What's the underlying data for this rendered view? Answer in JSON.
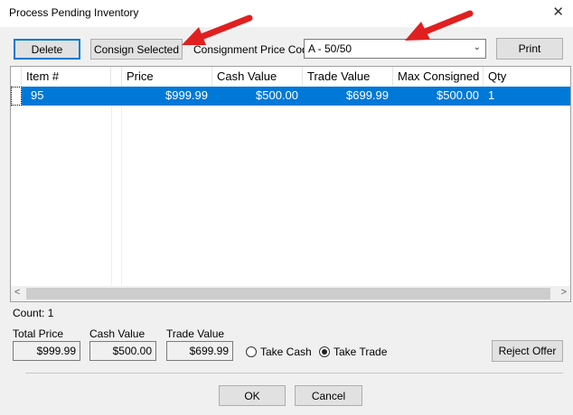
{
  "window": {
    "title": "Process Pending Inventory"
  },
  "toolbar": {
    "delete_label": "Delete",
    "consign_selected_label": "Consign Selected",
    "price_code_label": "Consignment Price Code",
    "price_code_value": "A - 50/50",
    "print_label": "Print"
  },
  "grid": {
    "columns": [
      "Item #",
      "Price",
      "Cash Value",
      "Trade Value",
      "Max Consigned",
      "Qty"
    ],
    "rows": [
      {
        "item": "95",
        "price": "$999.99",
        "cash": "$500.00",
        "trade": "$699.99",
        "max": "$500.00",
        "qty": "1"
      }
    ]
  },
  "summary": {
    "count_label": "Count: 1",
    "total_price_label": "Total Price",
    "total_price_value": "$999.99",
    "cash_value_label": "Cash Value",
    "cash_value_value": "$500.00",
    "trade_value_label": "Trade Value",
    "trade_value_value": "$699.99",
    "take_cash_label": "Take Cash",
    "take_trade_label": "Take Trade",
    "selected_option": "Take Trade",
    "reject_offer_label": "Reject Offer"
  },
  "footer": {
    "ok_label": "OK",
    "cancel_label": "Cancel"
  },
  "colors": {
    "selection": "#0078d7",
    "annotation_arrow": "#e02020"
  }
}
